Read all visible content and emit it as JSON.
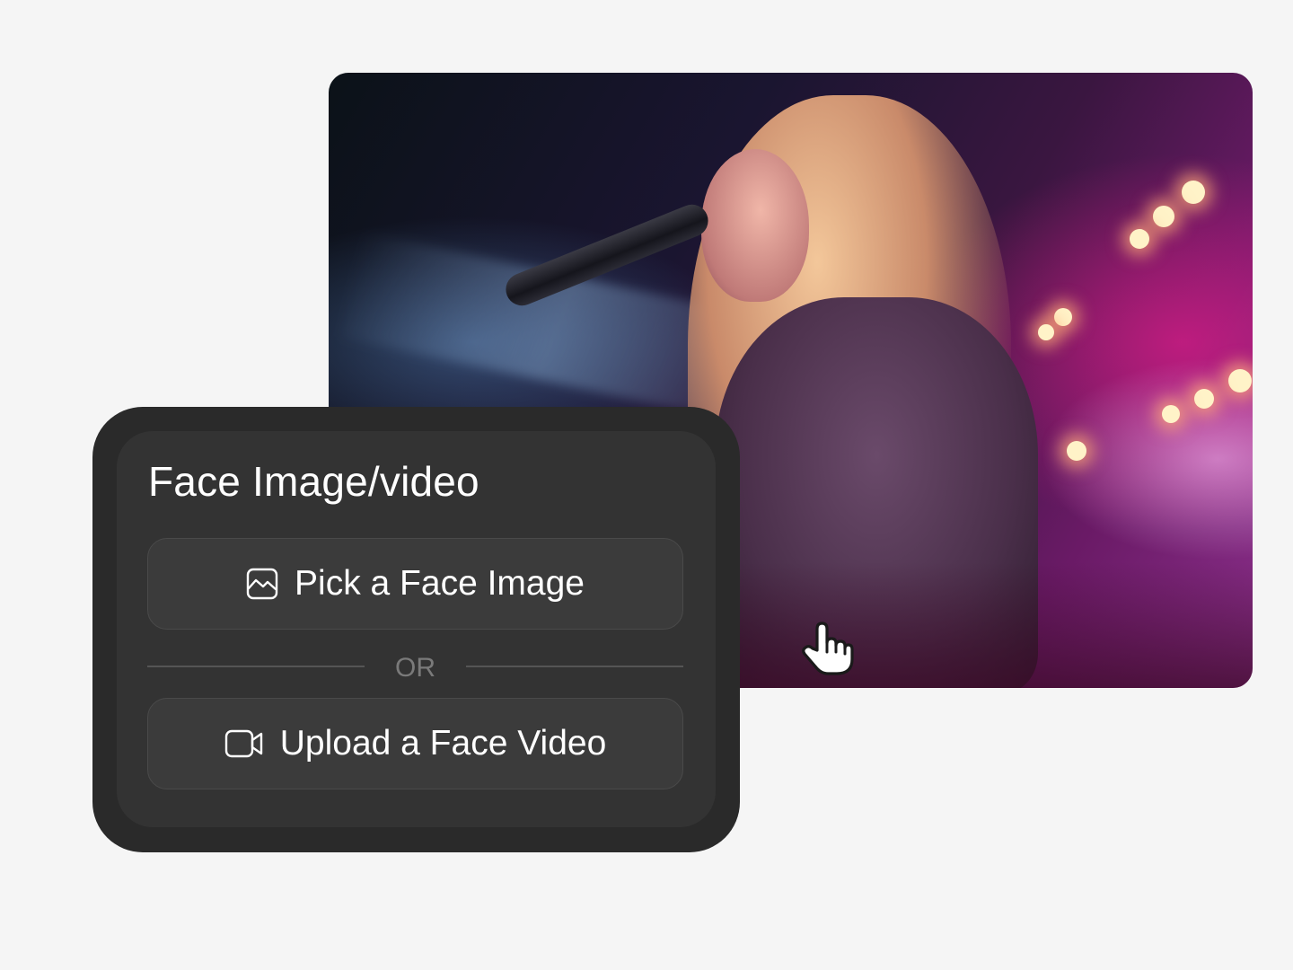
{
  "photo": {
    "icon": "concert-singer-photo"
  },
  "card": {
    "title": "Face Image/video",
    "pick_image_label": "Pick a Face Image",
    "upload_video_label": "Upload a Face Video",
    "or_label": "OR",
    "pick_image_icon": "image-icon",
    "upload_video_icon": "video-camera-icon"
  },
  "cursor": {
    "icon": "hand-pointer-icon"
  },
  "colors": {
    "background": "#f5f5f5",
    "card_outer": "#2a2a2a",
    "card_inner": "#333333",
    "button": "#3b3b3b",
    "text": "#ffffff",
    "muted_text": "#7a7a7a"
  }
}
